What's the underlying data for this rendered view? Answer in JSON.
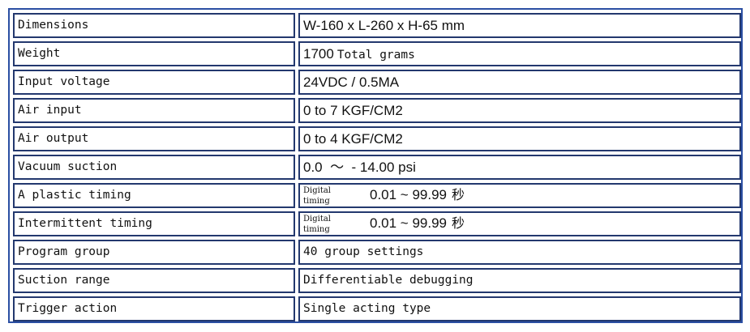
{
  "rows": [
    {
      "label": "Dimensions",
      "value": "W-160 x L-260 x H-65 mm"
    },
    {
      "label": "Weight",
      "value_prefix": "1700",
      "value_suffix": "Total grams"
    },
    {
      "label": "Input voltage",
      "value": "24VDC / 0.5MA"
    },
    {
      "label": "Air input",
      "value": "0 to 7 KGF/CM2"
    },
    {
      "label": "Air output",
      "value": "0 to 4 KGF/CM2"
    },
    {
      "label": "Vacuum suction",
      "value": "0.0  ～  - 14.00 psi"
    },
    {
      "label": "A plastic timing",
      "sub_label_1": "Digital",
      "sub_label_2": "timing",
      "range": "0.01 ~ 99.99",
      "unit": "秒"
    },
    {
      "label": "Intermittent timing",
      "sub_label_1": "Digital",
      "sub_label_2": "timing",
      "range": "0.01 ~ 99.99",
      "unit": "秒"
    },
    {
      "label": "Program group",
      "value": "40 group settings"
    },
    {
      "label": "Suction range",
      "value": "Differentiable debugging"
    },
    {
      "label": "Trigger action",
      "value": "Single acting type"
    }
  ],
  "colors": {
    "outer_border": "#2b4fa3",
    "cell_border": "#23386e",
    "text": "#111111"
  }
}
